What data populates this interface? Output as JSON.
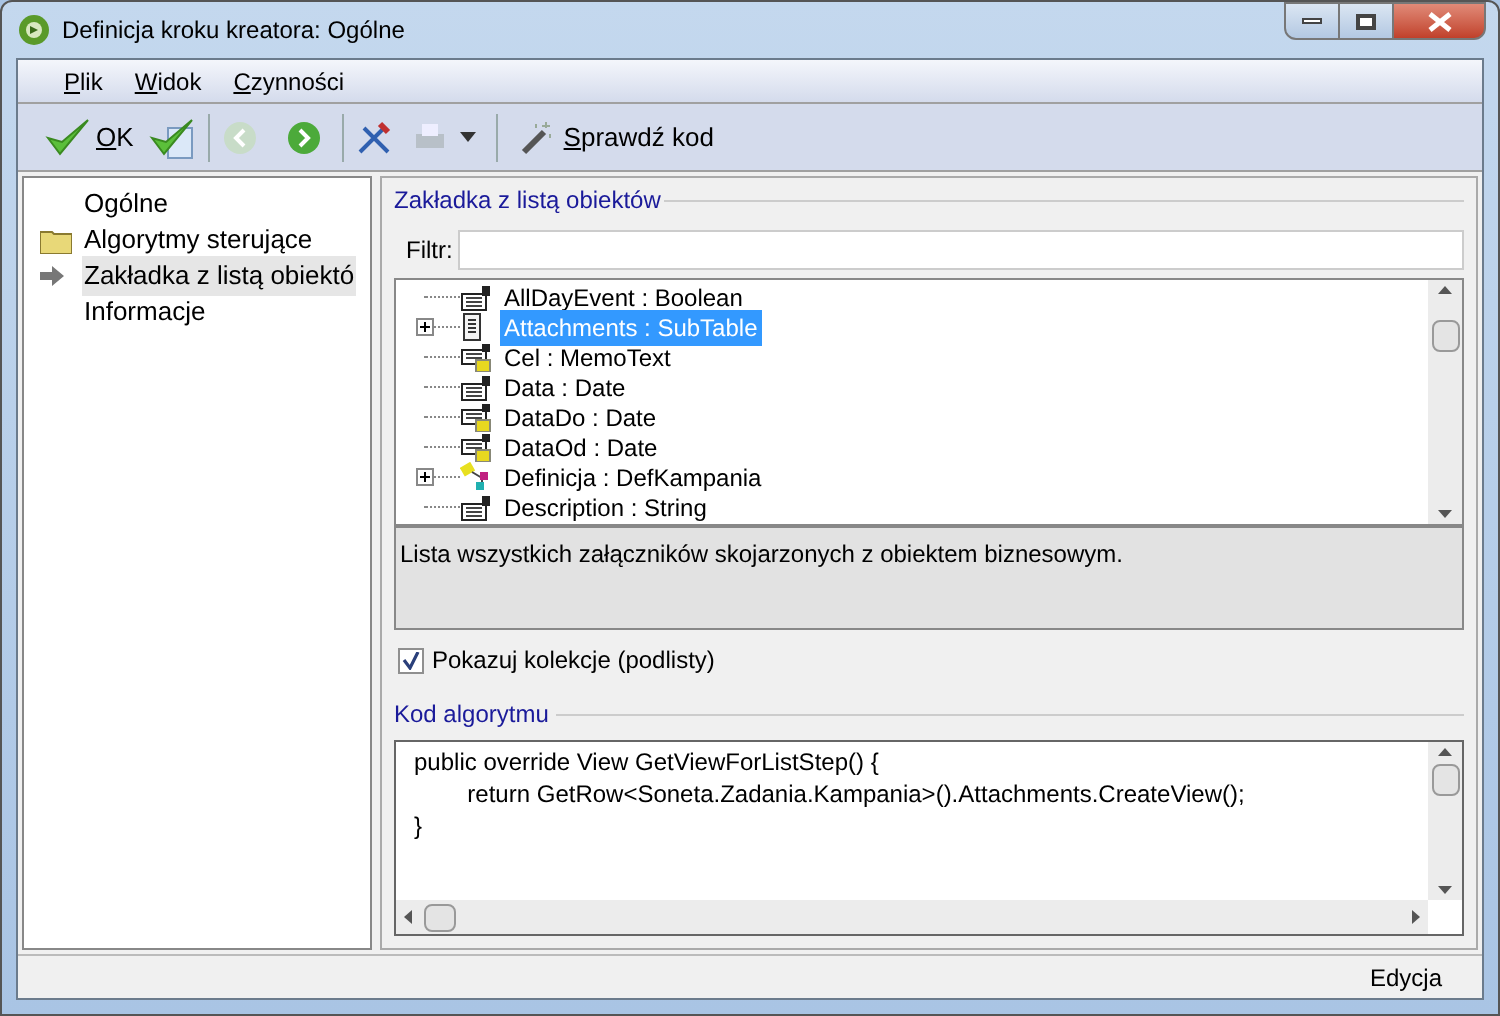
{
  "window": {
    "title": "Definicja kroku kreatora: Ogólne"
  },
  "menu": [
    "Plik",
    "Widok",
    "Czynności"
  ],
  "toolbar": {
    "ok_label": "OK",
    "check_label": "Sprawdź kod"
  },
  "nav": [
    {
      "label": "Ogólne",
      "kind": "plain",
      "selected": false
    },
    {
      "label": "Algorytmy sterujące",
      "kind": "folder",
      "selected": false
    },
    {
      "label": "Zakładka z listą obiektó",
      "kind": "current",
      "selected": true
    },
    {
      "label": "Informacje",
      "kind": "plain",
      "selected": false
    }
  ],
  "group_title": "Zakładka z listą obiektów",
  "filter": {
    "label": "Filtr:"
  },
  "tree": [
    {
      "label": "AllDayEvent : Boolean",
      "kind": "field",
      "expandable": false,
      "selected": false
    },
    {
      "label": "Attachments : SubTable",
      "kind": "subtable",
      "expandable": true,
      "selected": true
    },
    {
      "label": "Cel : MemoText",
      "kind": "field-yellow",
      "expandable": false,
      "selected": false
    },
    {
      "label": "Data : Date",
      "kind": "field",
      "expandable": false,
      "selected": false
    },
    {
      "label": "DataDo : Date",
      "kind": "field-yellow",
      "expandable": false,
      "selected": false
    },
    {
      "label": "DataOd : Date",
      "kind": "field-yellow",
      "expandable": false,
      "selected": false
    },
    {
      "label": "Definicja : DefKampania",
      "kind": "relation",
      "expandable": true,
      "selected": false
    },
    {
      "label": "Description : String",
      "kind": "field",
      "expandable": false,
      "selected": false
    }
  ],
  "description": "Lista wszystkich załączników skojarzonych z obiektem biznesowym.",
  "show_collections": {
    "label": "Pokazuj kolekcje (podlisty)",
    "checked": true
  },
  "code_title": "Kod algorytmu",
  "code_lines": [
    "public override View GetViewForListStep() {",
    "\treturn GetRow<Soneta.Zadania.Kampania>().Attachments.CreateView();",
    "}"
  ],
  "status_bar": "Edycja"
}
